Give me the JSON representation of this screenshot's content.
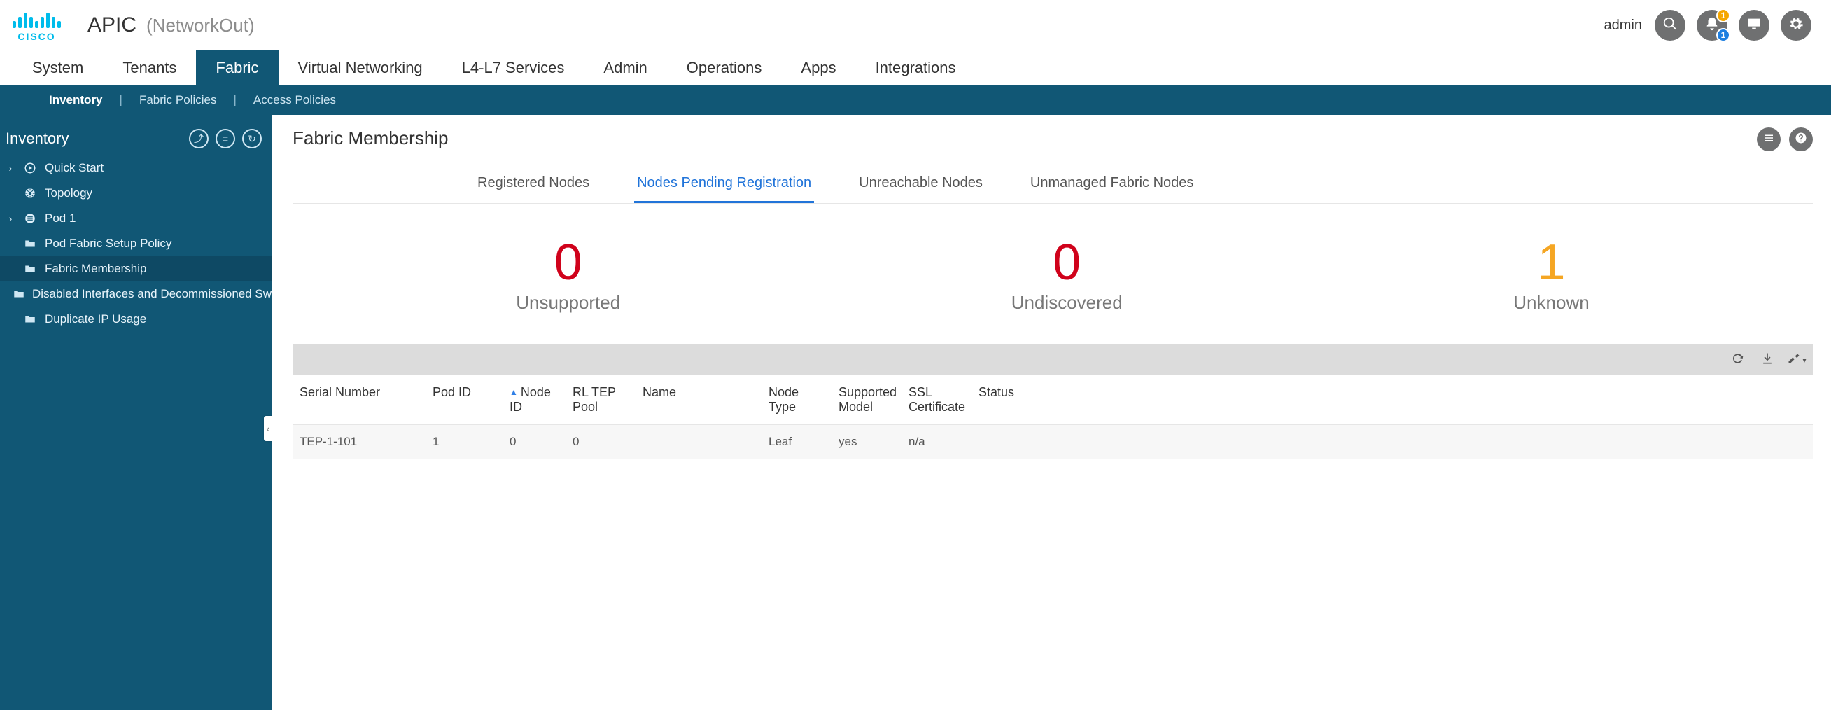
{
  "header": {
    "logo_word": "CISCO",
    "app_title": "APIC",
    "app_subtitle": "(NetworkOut)",
    "user": "admin",
    "notif_badge_top": "1",
    "notif_badge_bottom": "1"
  },
  "topnav": {
    "tabs": [
      {
        "label": "System",
        "active": false
      },
      {
        "label": "Tenants",
        "active": false
      },
      {
        "label": "Fabric",
        "active": true
      },
      {
        "label": "Virtual Networking",
        "active": false
      },
      {
        "label": "L4-L7 Services",
        "active": false
      },
      {
        "label": "Admin",
        "active": false
      },
      {
        "label": "Operations",
        "active": false
      },
      {
        "label": "Apps",
        "active": false
      },
      {
        "label": "Integrations",
        "active": false
      }
    ]
  },
  "subnav": {
    "items": [
      {
        "label": "Inventory",
        "active": true
      },
      {
        "label": "Fabric Policies",
        "active": false
      },
      {
        "label": "Access Policies",
        "active": false
      }
    ]
  },
  "sidebar": {
    "title": "Inventory",
    "items": [
      {
        "label": "Quick Start",
        "icon": "play",
        "caret": true,
        "selected": false
      },
      {
        "label": "Topology",
        "icon": "topology",
        "caret": false,
        "selected": false
      },
      {
        "label": "Pod 1",
        "icon": "pod",
        "caret": true,
        "selected": false
      },
      {
        "label": "Pod Fabric Setup Policy",
        "icon": "folder",
        "caret": false,
        "selected": false
      },
      {
        "label": "Fabric Membership",
        "icon": "folder",
        "caret": false,
        "selected": true
      },
      {
        "label": "Disabled Interfaces and Decommissioned Switch...",
        "icon": "folder",
        "caret": false,
        "selected": false
      },
      {
        "label": "Duplicate IP Usage",
        "icon": "folder",
        "caret": false,
        "selected": false
      }
    ]
  },
  "page": {
    "title": "Fabric Membership",
    "tabs": [
      {
        "label": "Registered Nodes",
        "active": false
      },
      {
        "label": "Nodes Pending Registration",
        "active": true
      },
      {
        "label": "Unreachable Nodes",
        "active": false
      },
      {
        "label": "Unmanaged Fabric Nodes",
        "active": false
      }
    ],
    "kpis": [
      {
        "value": "0",
        "label": "Unsupported",
        "color": "red"
      },
      {
        "value": "0",
        "label": "Undiscovered",
        "color": "red"
      },
      {
        "value": "1",
        "label": "Unknown",
        "color": "orange"
      }
    ],
    "table": {
      "columns": [
        {
          "label": "Serial Number",
          "sorted": false
        },
        {
          "label": "Pod ID",
          "sorted": false
        },
        {
          "label": "Node ID",
          "sorted": true
        },
        {
          "label": "RL TEP Pool",
          "sorted": false
        },
        {
          "label": "Name",
          "sorted": false
        },
        {
          "label": "Node Type",
          "sorted": false
        },
        {
          "label": "Supported Model",
          "sorted": false
        },
        {
          "label": "SSL Certificate",
          "sorted": false
        },
        {
          "label": "Status",
          "sorted": false
        }
      ],
      "rows": [
        {
          "serial": "TEP-1-101",
          "pod": "1",
          "node": "0",
          "tep": "0",
          "name": "",
          "ntype": "Leaf",
          "model": "yes",
          "ssl": "n/a",
          "status": ""
        }
      ]
    }
  }
}
